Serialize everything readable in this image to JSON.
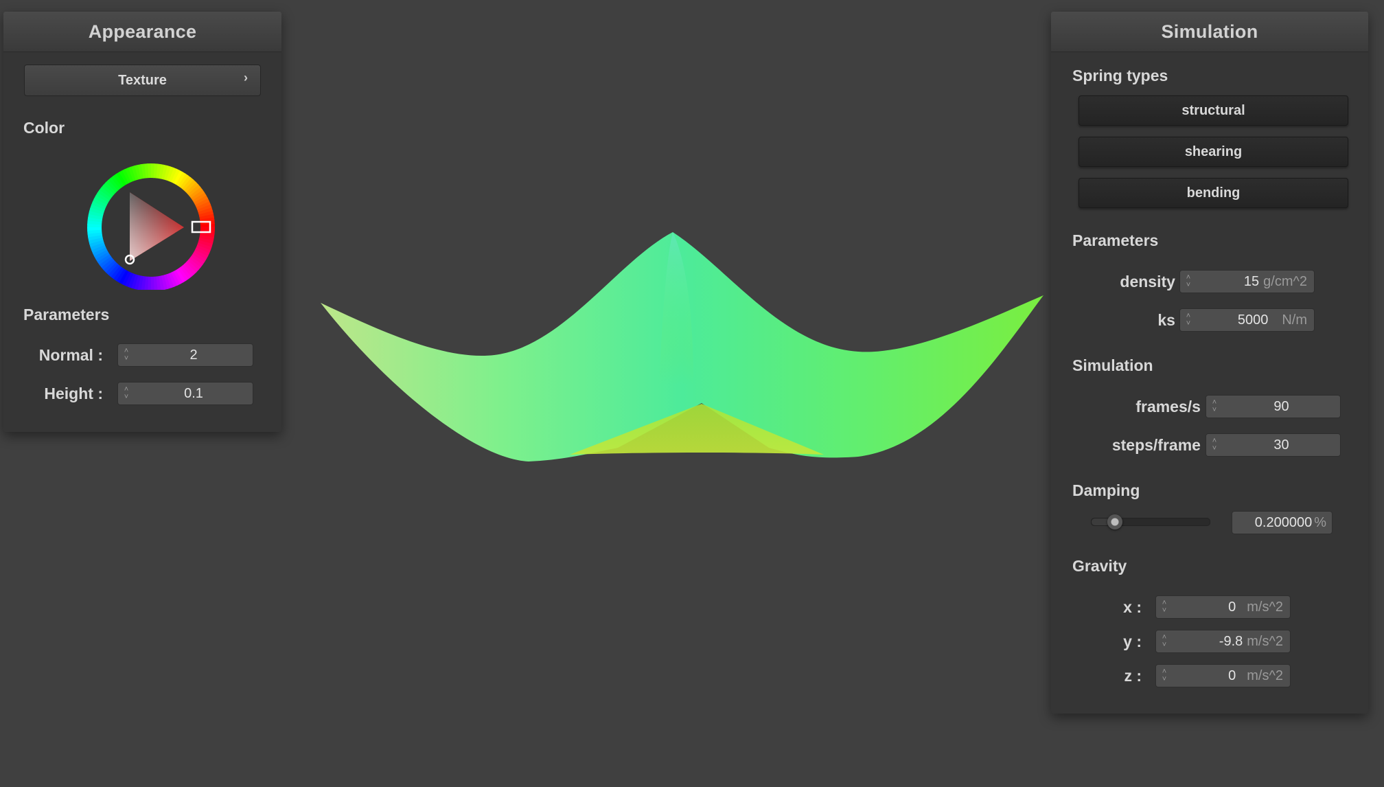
{
  "appearance": {
    "title": "Appearance",
    "texture_label": "Texture",
    "color_label": "Color",
    "parameters_label": "Parameters",
    "normal_label": "Normal :",
    "normal_value": "2",
    "height_label": "Height :",
    "height_value": "0.1",
    "selected_color": "#ff0000"
  },
  "simulation": {
    "title": "Simulation",
    "spring_types_label": "Spring types",
    "spring_buttons": [
      "structural",
      "shearing",
      "bending"
    ],
    "parameters_label": "Parameters",
    "density_label": "density :",
    "density_value": "15",
    "density_unit": "g/cm^2",
    "ks_label": "ks :",
    "ks_value": "5000",
    "ks_unit": "N/m",
    "simulation_label": "Simulation",
    "fps_label": "frames/s :",
    "fps_value": "90",
    "steps_label": "steps/frame :",
    "steps_value": "30",
    "damping_label": "Damping",
    "damping_value": "0.200000",
    "damping_unit": "%",
    "damping_fraction": 0.2,
    "gravity_label": "Gravity",
    "gx_label": "x :",
    "gx_value": "0",
    "gy_label": "y :",
    "gy_value": "-9.8",
    "gz_label": "z :",
    "gz_value": "0",
    "gravity_unit": "m/s^2"
  }
}
